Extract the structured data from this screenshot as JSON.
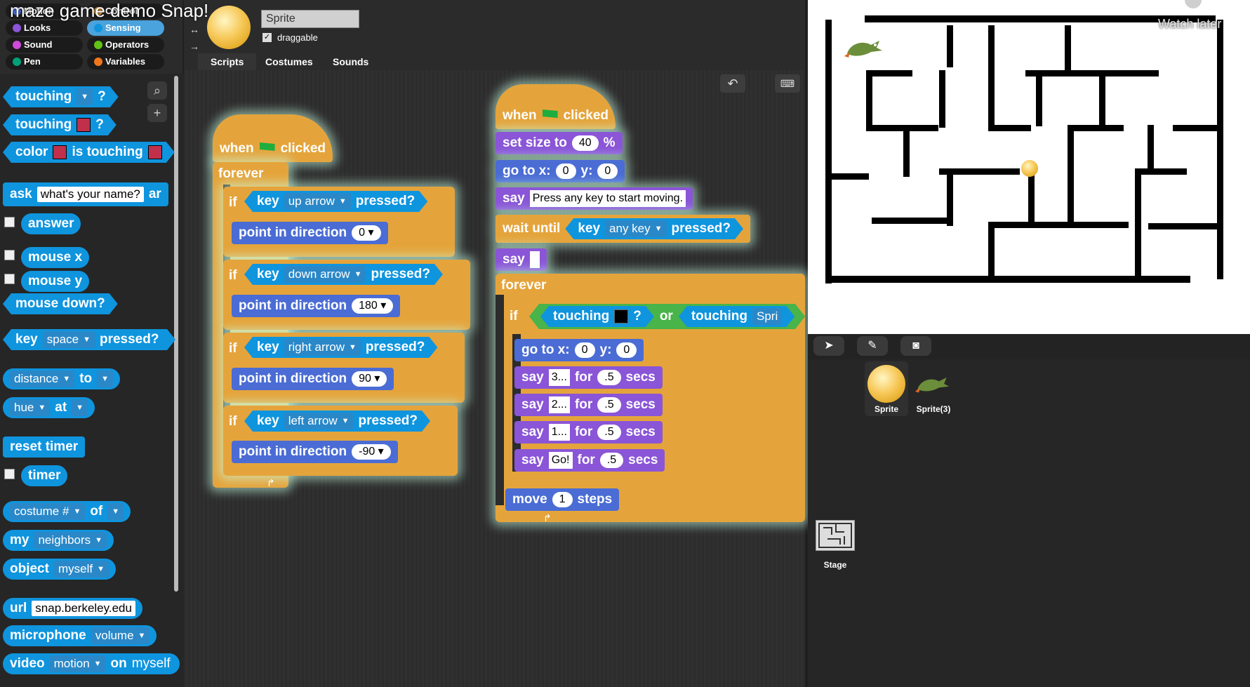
{
  "video": {
    "title": "maze game demo Snap!",
    "watch_later": "Watch later"
  },
  "categories": [
    {
      "label": "Motion",
      "color": "#4a6cd4"
    },
    {
      "label": "Control",
      "color": "#e5a43b"
    },
    {
      "label": "Looks",
      "color": "#8a55d7"
    },
    {
      "label": "Sensing",
      "color": "#0f94de"
    },
    {
      "label": "Sound",
      "color": "#cf4ad9"
    },
    {
      "label": "Operators",
      "color": "#62c213"
    },
    {
      "label": "Pen",
      "color": "#00a178"
    },
    {
      "label": "Variables",
      "color": "#f3761d"
    }
  ],
  "active_category": "Sensing",
  "palette": {
    "touching": "touching",
    "q": "?",
    "color": "color",
    "is_touching": "is touching",
    "ask": "ask",
    "ask_default": "what's your name?",
    "ask_suffix": "ar",
    "answer": "answer",
    "mouse_x": "mouse x",
    "mouse_y": "mouse y",
    "mouse_down": "mouse down?",
    "key": "key",
    "key_value": "space",
    "pressed": "pressed?",
    "distance": "distance",
    "to": "to",
    "hue": "hue",
    "at": "at",
    "reset_timer": "reset timer",
    "timer": "timer",
    "costume_num": "costume #",
    "of": "of",
    "my": "my",
    "neighbors": "neighbors",
    "object": "object",
    "myself": "myself",
    "url": "url",
    "url_value": "snap.berkeley.edu",
    "microphone": "microphone",
    "volume": "volume",
    "video": "video",
    "motion": "motion",
    "on": "on",
    "myself_cut": "myself"
  },
  "sprite": {
    "name": "Sprite",
    "draggable_label": "draggable",
    "draggable": true
  },
  "tabs": [
    "Scripts",
    "Costumes",
    "Sounds"
  ],
  "script1": {
    "when": "when",
    "clicked": "clicked",
    "forever": "forever",
    "if": "if",
    "key": "key",
    "pressed": "pressed?",
    "point": "point in direction",
    "rows": [
      {
        "key": "up arrow",
        "dir": "0"
      },
      {
        "key": "down arrow",
        "dir": "180"
      },
      {
        "key": "right arrow",
        "dir": "90"
      },
      {
        "key": "left arrow",
        "dir": "-90"
      }
    ]
  },
  "script2": {
    "set_size": "set size to",
    "size": "40",
    "pct": "%",
    "goto": "go to x:",
    "y": "y:",
    "x0": "0",
    "y0": "0",
    "say": "say",
    "say_msg": "Press any key to start moving.",
    "wait_until": "wait until",
    "any_key": "any key",
    "forever": "forever",
    "if": "if",
    "touching": "touching",
    "q": "?",
    "or": "or",
    "sprite_cut": "Spri",
    "for": "for",
    "secs": "secs",
    "count": [
      {
        "msg": "3...",
        "secs": ".5"
      },
      {
        "msg": "2...",
        "secs": ".5"
      },
      {
        "msg": "1...",
        "secs": ".5"
      },
      {
        "msg": "Go!",
        "secs": ".5"
      }
    ],
    "move": "move",
    "steps_n": "1",
    "steps": "steps"
  },
  "corral": {
    "sprites": [
      "Sprite",
      "Sprite(3)"
    ],
    "stage": "Stage"
  }
}
